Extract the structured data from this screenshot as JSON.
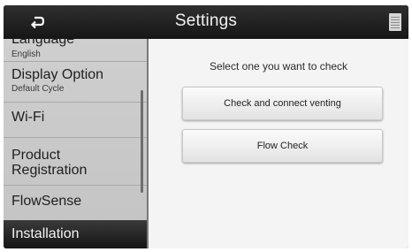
{
  "header": {
    "title": "Settings",
    "back_icon": "back-arrow-icon",
    "menu_icon": "menu-icon"
  },
  "sidebar": {
    "items": [
      {
        "label": "Language",
        "sublabel": "English"
      },
      {
        "label": "Display Option",
        "sublabel": "Default Cycle"
      },
      {
        "label": "Wi-Fi"
      },
      {
        "label": "Product Registration"
      },
      {
        "label": "FlowSense"
      }
    ],
    "selected": {
      "label": "Installation"
    }
  },
  "main": {
    "prompt": "Select one you want to check",
    "buttons": [
      {
        "label": "Check and connect venting"
      },
      {
        "label": "Flow Check"
      }
    ]
  },
  "colors": {
    "header_bg": "#1c1c1c",
    "sidebar_bg": "#c9c9c9",
    "selected_bg": "#222222",
    "content_bg": "#f4f4f4"
  }
}
